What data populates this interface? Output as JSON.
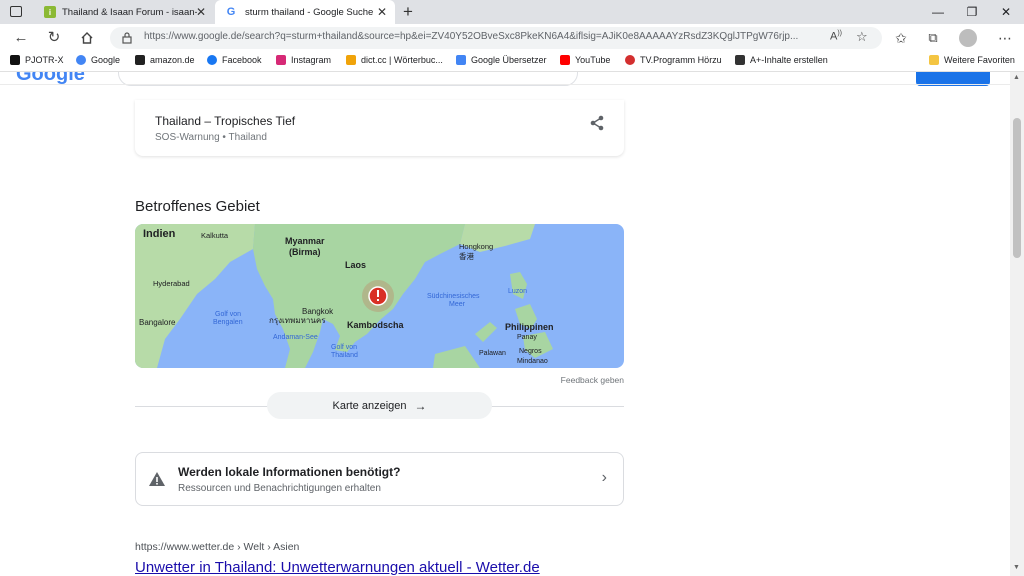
{
  "browser": {
    "tabs": [
      {
        "title": "Thailand & Isaan Forum - isaan-",
        "active": false
      },
      {
        "title": "sturm thailand - Google Suche",
        "active": true
      }
    ],
    "url": "https://www.google.de/search?q=sturm+thailand&source=hp&ei=ZV40Y52OBveSxc8PkeKN6A4&iflsig=AJiK0e8AAAAAYzRsdZ3KQglJTPgW76rjp...",
    "bookmarks": [
      {
        "label": "PJOTR-X",
        "icon": "pjotr-icon",
        "color": "#111111"
      },
      {
        "label": "Google",
        "icon": "google-icon",
        "color": "#4285f4"
      },
      {
        "label": "amazon.de",
        "icon": "amazon-icon",
        "color": "#222222"
      },
      {
        "label": "Facebook",
        "icon": "facebook-icon",
        "color": "#1877f2"
      },
      {
        "label": "Instagram",
        "icon": "instagram-icon",
        "color": "#d62976"
      },
      {
        "label": "dict.cc | Wörterbuc...",
        "icon": "dictcc-icon",
        "color": "#f0a30a"
      },
      {
        "label": "Google Übersetzer",
        "icon": "translate-icon",
        "color": "#4285f4"
      },
      {
        "label": "YouTube",
        "icon": "youtube-icon",
        "color": "#ff0000"
      },
      {
        "label": "TV.Programm Hörzu",
        "icon": "heart-icon",
        "color": "#d32f2f"
      },
      {
        "label": "A+-Inhalte erstellen",
        "icon": "aplus-icon",
        "color": "#333333"
      }
    ],
    "other_favorites": "Weitere Favoriten"
  },
  "page": {
    "google_logo": "Google",
    "sos_card": {
      "title": "Thailand – Tropisches Tief",
      "subtitle": "SOS-Warnung • Thailand"
    },
    "affected_area": {
      "heading": "Betroffenes Gebiet",
      "map_labels": {
        "indien": "Indien",
        "kalkutta": "Kalkutta",
        "myanmar": "Myanmar",
        "birma": "(Birma)",
        "hongkong": "Hongkong",
        "hongkong_cn": "香港",
        "laos": "Laos",
        "hyderabad": "Hyderabad",
        "luzon": "Luzon",
        "suedchin1": "Südchinesisches",
        "suedchin2": "Meer",
        "bangkok": "Bangkok",
        "bangkok_th": "กรุงเทพมหานคร",
        "golf_bengalen1": "Golf von",
        "golf_bengalen2": "Bengalen",
        "bangalore": "Bangalore",
        "kambodscha": "Kambodscha",
        "andaman": "Andaman-See",
        "philippinen": "Philippinen",
        "panay": "Panay",
        "golf_thailand1": "Golf von",
        "golf_thailand2": "Thailand",
        "palawan": "Palawan",
        "negros": "Negros",
        "mindanao": "Mindanao"
      },
      "feedback": "Feedback geben",
      "map_button": "Karte anzeigen"
    },
    "local_info": {
      "title": "Werden lokale Informationen benötigt?",
      "subtitle": "Ressourcen und Benachrichtigungen erhalten"
    },
    "result": {
      "url": "https://www.wetter.de › Welt › Asien",
      "title": "Unwetter in Thailand: Unwetterwarnungen aktuell - Wetter.de"
    }
  },
  "colors": {
    "link": "#1a0dab",
    "accent": "#1a73e8",
    "alert_red": "#d93025",
    "map_water": "#8ab4f8",
    "map_land": "#a8d5a2"
  }
}
